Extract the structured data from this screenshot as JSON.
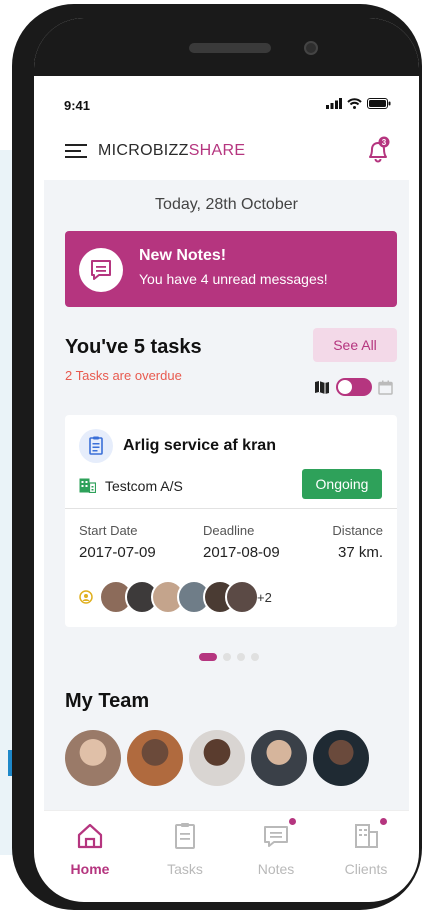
{
  "status_bar": {
    "time": "9:41"
  },
  "app": {
    "brand_part1": "MICROBIZZ",
    "brand_part2": "SHARE",
    "notification_count": "3"
  },
  "home": {
    "date": "Today, 28th October",
    "notes_banner": {
      "title": "New Notes!",
      "message": "You have 4 unread messages!"
    },
    "tasks_title": "You've 5 tasks",
    "tasks_overdue": "2 Tasks are overdue",
    "see_all_label": "See All"
  },
  "task": {
    "name": "Arlig service af kran",
    "company": "Testcom A/S",
    "status": "Ongoing",
    "start_label": "Start Date",
    "start_value": "2017-07-09",
    "deadline_label": "Deadline",
    "deadline_value": "2017-08-09",
    "distance_label": "Distance",
    "distance_value": "37 km.",
    "extra_members": "+2"
  },
  "carousel": {
    "pages": 4,
    "active": 1
  },
  "team": {
    "title": "My Team"
  },
  "tabs": [
    {
      "label": "Home",
      "icon": "home-icon",
      "active": true
    },
    {
      "label": "Tasks",
      "icon": "clipboard-icon",
      "active": false
    },
    {
      "label": "Notes",
      "icon": "notes-icon",
      "active": false
    },
    {
      "label": "Clients",
      "icon": "clients-icon",
      "active": false
    }
  ],
  "colors": {
    "accent": "#b5357f",
    "overdue": "#e85a4f",
    "ongoing": "#2ea15a",
    "background": "#f2f4f7"
  }
}
